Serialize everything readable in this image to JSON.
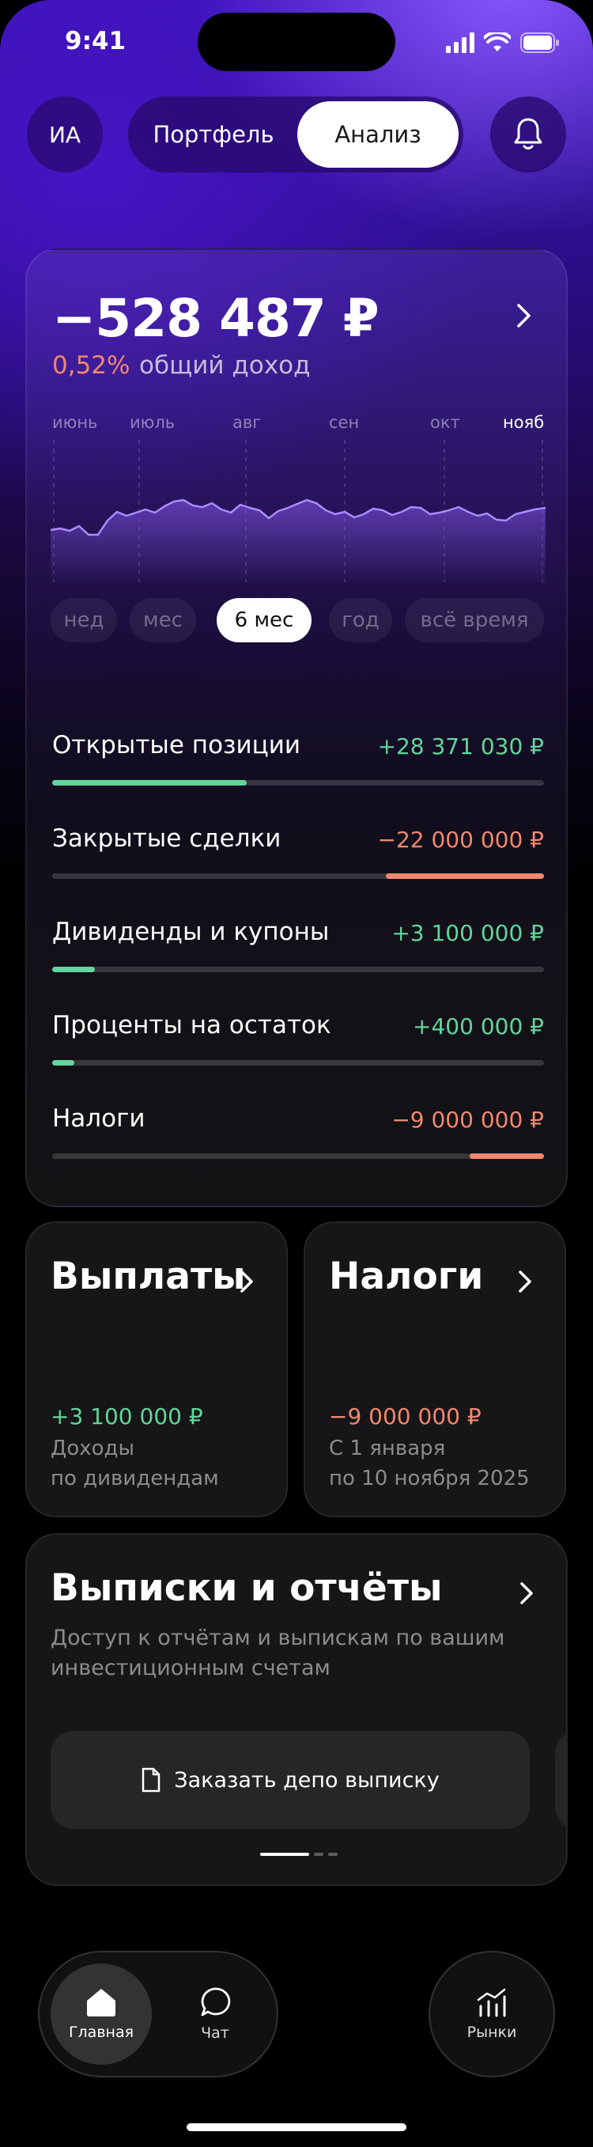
{
  "status_bar": {
    "time": "9:41"
  },
  "header": {
    "avatar_initials": "ИА",
    "tabs": [
      {
        "label": "Портфель",
        "active": false
      },
      {
        "label": "Анализ",
        "active": true
      }
    ]
  },
  "summary": {
    "total": "−528 487 ₽",
    "percent": "0,52%",
    "percent_label": "общий доход",
    "chart": {
      "months": [
        "июнь",
        "июль",
        "авг",
        "сен",
        "окт",
        "нояб"
      ],
      "active_month": "нояб"
    },
    "periods": [
      {
        "label": "нед",
        "active": false
      },
      {
        "label": "мес",
        "active": false
      },
      {
        "label": "6 мес",
        "active": true
      },
      {
        "label": "год",
        "active": false
      },
      {
        "label": "всё время",
        "active": false
      }
    ],
    "metrics": [
      {
        "label": "Открытые позиции",
        "value": "+28 371 030 ₽",
        "tone": "positive",
        "bar_fraction": 0.4
      },
      {
        "label": "Закрытые сделки",
        "value": "−22 000 000 ₽",
        "tone": "negative",
        "bar_fraction": 0.32
      },
      {
        "label": "Дивиденды и купоны",
        "value": "+3 100 000 ₽",
        "tone": "positive",
        "bar_fraction": 0.09
      },
      {
        "label": "Проценты на остаток",
        "value": "+400 000 ₽",
        "tone": "positive",
        "bar_fraction": 0.045
      },
      {
        "label": "Налоги",
        "value": "−9 000 000 ₽",
        "tone": "negative",
        "bar_fraction": 0.15
      }
    ]
  },
  "payouts_card": {
    "title": "Выплаты",
    "amount": "+3 100 000 ₽",
    "subtitle_1": "Доходы",
    "subtitle_2": "по дивидендам"
  },
  "taxes_card": {
    "title": "Налоги",
    "amount": "−9 000 000 ₽",
    "subtitle_1": "С 1 января",
    "subtitle_2": "по 10 ноября 2025"
  },
  "reports_card": {
    "title": "Выписки и отчёты",
    "description": "Доступ к отчётам и выпискам по вашим инвестиционным счетам",
    "button_label": "Заказать депо выписку"
  },
  "tab_bar": {
    "items": [
      {
        "label": "Главная",
        "icon": "home-icon",
        "active": true
      },
      {
        "label": "Чат",
        "icon": "chat-icon",
        "active": false
      }
    ],
    "markets": {
      "label": "Рынки",
      "icon": "chart-icon"
    }
  },
  "colors": {
    "positive": "#62d59a",
    "negative": "#f0876e",
    "accent": "#3b14b8"
  }
}
